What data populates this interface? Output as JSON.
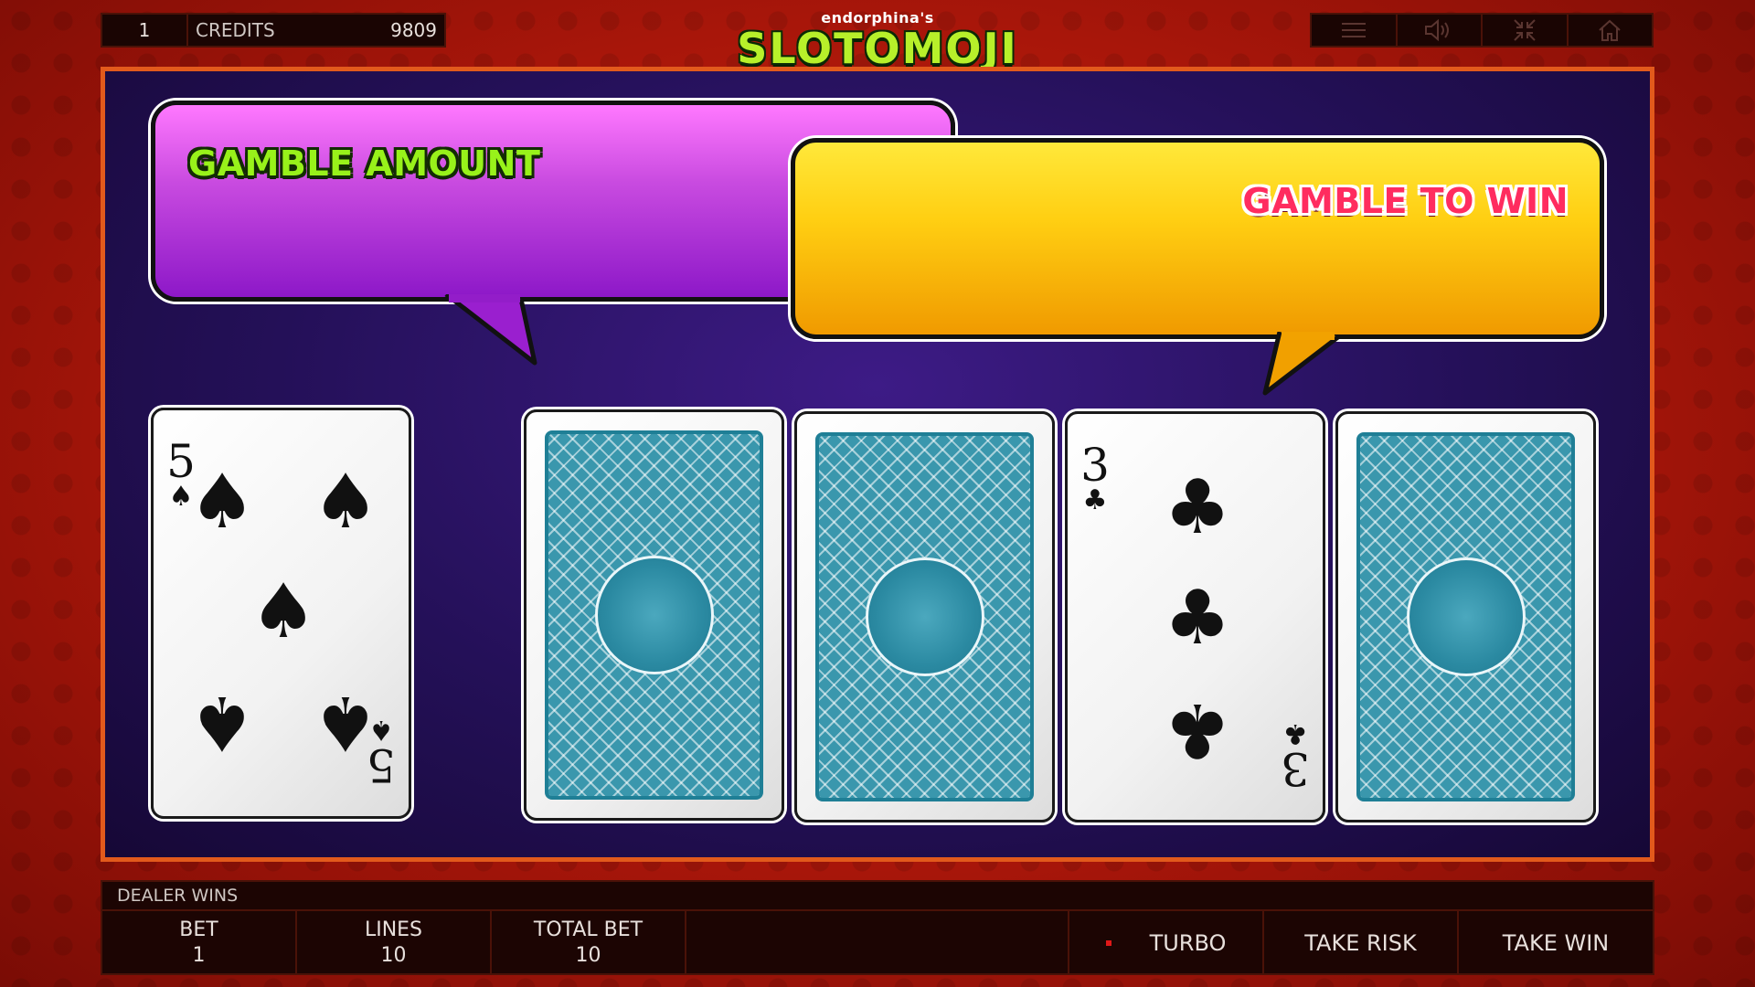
{
  "header": {
    "lines_value": "1",
    "credits_label": "CREDITS",
    "credits_value": "9809",
    "logo_sub": "endorphina's",
    "logo_main": "SLOTOMOJI",
    "controls": [
      "menu-icon",
      "sound-icon",
      "minimize-icon",
      "home-icon"
    ]
  },
  "gamble": {
    "amount_label": "GAMBLE AMOUNT",
    "win_label": "GAMBLE TO WIN"
  },
  "cards": {
    "dealer": {
      "rank": "5",
      "suit": "♠"
    },
    "player": [
      {
        "face": "back"
      },
      {
        "face": "back"
      },
      {
        "face": "up",
        "rank": "3",
        "suit": "♣"
      },
      {
        "face": "back"
      }
    ]
  },
  "footer": {
    "status": "DEALER WINS",
    "bet_label": "BET",
    "bet_value": "1",
    "lines_label": "LINES",
    "lines_value": "10",
    "total_bet_label": "TOTAL BET",
    "total_bet_value": "10",
    "turbo_label": "TURBO",
    "take_risk_label": "TAKE RISK",
    "take_win_label": "TAKE WIN"
  },
  "colors": {
    "frame_border": "#e25a1c",
    "purple_bubble": "#c94be0",
    "yellow_bubble": "#ffcf12",
    "amount_text": "#98f21a",
    "win_text": "#ff2c5f",
    "card_back": "#3a97ad"
  }
}
